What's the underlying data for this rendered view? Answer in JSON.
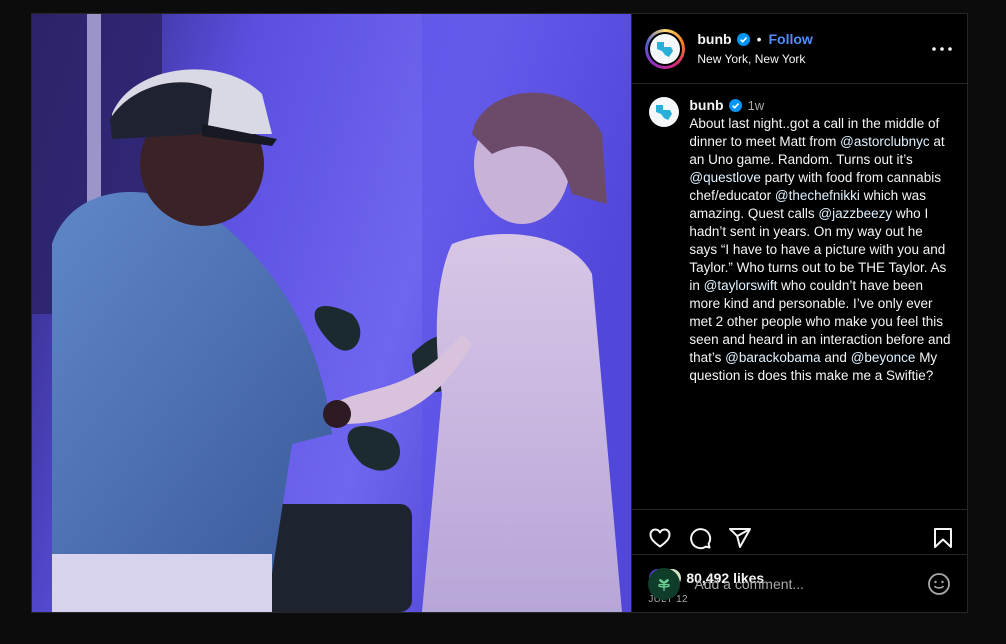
{
  "header": {
    "username": "bunb",
    "separator": "•",
    "follow_label": "Follow",
    "location": "New York, New York"
  },
  "caption": {
    "username": "bunb",
    "time": "1w",
    "segments": [
      {
        "text": "About last night..got a call in the middle of dinner to meet Matt from ",
        "mention": false
      },
      {
        "text": "@astorclubnyc",
        "mention": true
      },
      {
        "text": " at an Uno game. Random. Turns out it’s ",
        "mention": false
      },
      {
        "text": "@questlove",
        "mention": true
      },
      {
        "text": " party with food from cannabis chef/educator ",
        "mention": false
      },
      {
        "text": "@thechefnikki",
        "mention": true
      },
      {
        "text": " which was amazing. Quest calls ",
        "mention": false
      },
      {
        "text": "@jazzbeezy",
        "mention": true
      },
      {
        "text": " who I hadn’t sent in years. On my way out he says “I have to have a picture with you and Taylor.” Who turns out to be THE Taylor. As in ",
        "mention": false
      },
      {
        "text": "@taylorswift",
        "mention": true
      },
      {
        "text": " who couldn’t have been more kind and personable. I’ve only ever met 2 other people who make you feel this seen and heard in an interaction before and that’s ",
        "mention": false
      },
      {
        "text": "@barackobama",
        "mention": true
      },
      {
        "text": " and ",
        "mention": false
      },
      {
        "text": "@beyonce",
        "mention": true
      },
      {
        "text": " My question is does this make me a Swiftie?",
        "mention": false
      }
    ]
  },
  "actions": {
    "like_icon": "heart-icon",
    "comment_icon": "comment-bubble-icon",
    "share_icon": "paper-plane-icon",
    "save_icon": "bookmark-icon"
  },
  "likes": {
    "count_text": "80,492 likes"
  },
  "date": "JULY 12",
  "comment": {
    "placeholder": "Add a comment...",
    "emoji_icon": "smiley-icon"
  },
  "colors": {
    "accent_link": "#4f8eff",
    "verified": "#0095f6",
    "background": "#000000"
  }
}
